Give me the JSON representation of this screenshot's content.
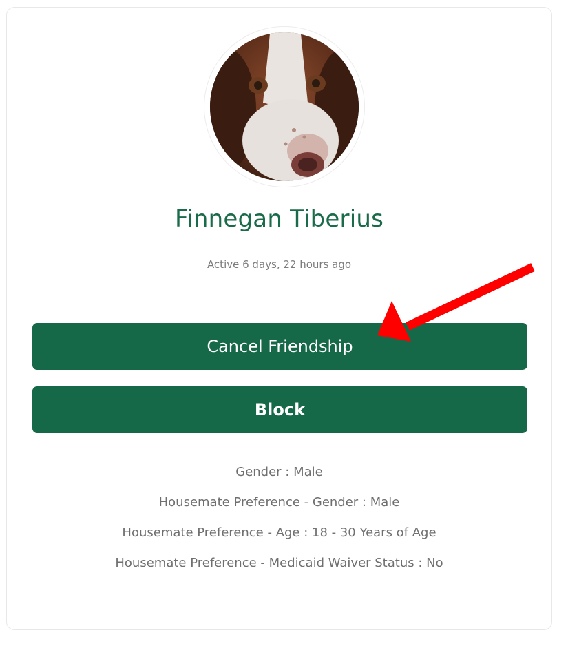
{
  "profile": {
    "name": "Finnegan Tiberius",
    "last_active": "Active 6 days, 22 hours ago",
    "avatar_description": "dog-avatar"
  },
  "actions": {
    "cancel_friendship_label": "Cancel Friendship",
    "block_label": "Block"
  },
  "details": [
    "Gender : Male",
    "Housemate Preference - Gender : Male",
    "Housemate Preference - Age : 18 - 30 Years of Age",
    "Housemate Preference - Medicaid Waiver Status : No"
  ],
  "colors": {
    "accent": "#166948",
    "name_text": "#1a6b49",
    "arrow": "#ff0000"
  }
}
